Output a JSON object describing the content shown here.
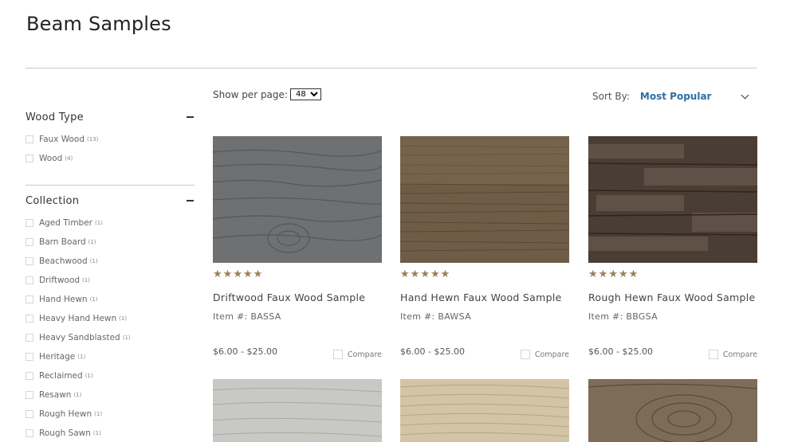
{
  "page": {
    "title": "Beam Samples"
  },
  "facets": [
    {
      "title": "Wood Type",
      "items": [
        {
          "label": "Faux Wood",
          "count": "(13)"
        },
        {
          "label": "Wood",
          "count": "(4)"
        }
      ]
    },
    {
      "title": "Collection",
      "items": [
        {
          "label": "Aged Timber",
          "count": "(1)"
        },
        {
          "label": "Barn Board",
          "count": "(1)"
        },
        {
          "label": "Beachwood",
          "count": "(1)"
        },
        {
          "label": "Driftwood",
          "count": "(1)"
        },
        {
          "label": "Hand Hewn",
          "count": "(1)"
        },
        {
          "label": "Heavy Hand Hewn",
          "count": "(1)"
        },
        {
          "label": "Heavy Sandblasted",
          "count": "(1)"
        },
        {
          "label": "Heritage",
          "count": "(1)"
        },
        {
          "label": "Reclaimed",
          "count": "(1)"
        },
        {
          "label": "Resawn",
          "count": "(1)"
        },
        {
          "label": "Rough Hewn",
          "count": "(1)"
        },
        {
          "label": "Rough Sawn",
          "count": "(1)"
        }
      ]
    }
  ],
  "toolbar": {
    "per_page_label": "Show per page:",
    "per_page_value": "48",
    "sort_label": "Sort By:",
    "sort_value": "Most Popular"
  },
  "products": [
    {
      "name": "Driftwood Faux Wood Sample",
      "sku": "Item #: BASSA",
      "price": "$6.00 - $25.00",
      "compare": "Compare",
      "rating": 5,
      "color": "#6b6d6c"
    },
    {
      "name": "Hand Hewn Faux Wood Sample",
      "sku": "Item #: BAWSA",
      "price": "$6.00 - $25.00",
      "compare": "Compare",
      "rating": 5,
      "color": "#6b5843"
    },
    {
      "name": "Rough Hewn Faux Wood Sample",
      "sku": "Item #: BBGSA",
      "price": "$6.00 - $25.00",
      "compare": "Compare",
      "rating": 5,
      "color": "#4a3d34"
    }
  ],
  "products_row2_colors": [
    "#c4c4c0",
    "#d2c2a4",
    "#7a6a55"
  ],
  "colors": {
    "accent": "#2f6ea0",
    "star": "#9c7e55",
    "rule": "#cfc9b8"
  }
}
